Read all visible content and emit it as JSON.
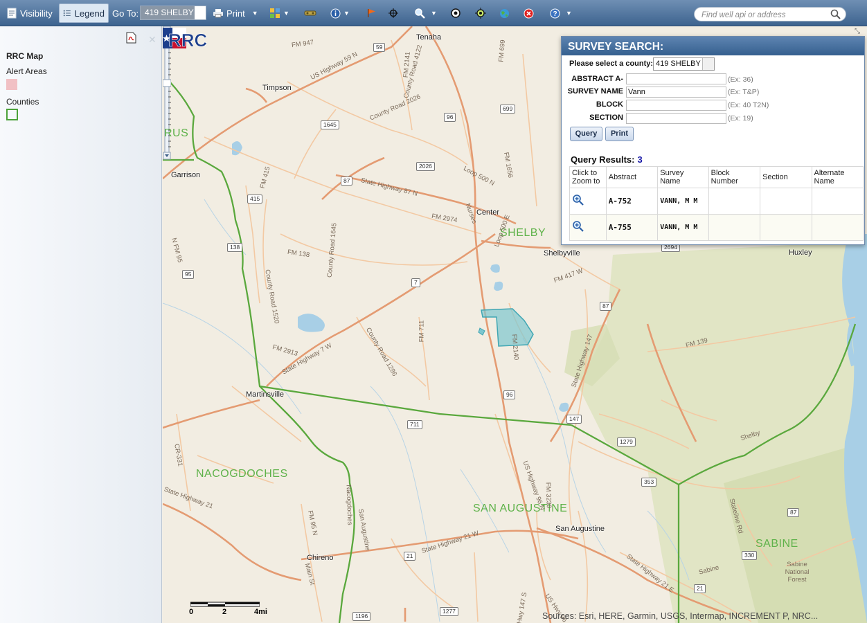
{
  "toolbar": {
    "visibility_label": "Visibility",
    "legend_label": "Legend",
    "goto_label": "Go To:",
    "goto_value": "419 SHELBY",
    "print_label": "Print",
    "search_placeholder": "Find well api or address"
  },
  "legend": {
    "title": "RRC Map",
    "items": [
      {
        "label": "Alert Areas",
        "color": "#f1c0c4"
      },
      {
        "label": "Counties",
        "color": "#4ca23a"
      }
    ]
  },
  "map": {
    "towns": [
      "Tenaha",
      "Timpson",
      "Garrison",
      "Center",
      "Shelbyville",
      "Huxley",
      "Martinsville",
      "Chireno",
      "San Augustine"
    ],
    "counties": [
      "SHELBY",
      "NACOGDOCHES",
      "SAN AUGUSTINE",
      "SABINE",
      "RUS"
    ],
    "roads": [
      "US Highway 59 N",
      "FM 947",
      "County Road 4122",
      "FM 2141",
      "FM 699",
      "County Road 2026",
      "Loop 500 N",
      "FM 1656",
      "State Highway 87 N",
      "FM 415",
      "FM 2974",
      "Loop 500 E",
      "FM 138",
      "County Road 1645",
      "FM 417 W",
      "County Road 1520",
      "FM 711",
      "FM 2913",
      "State Highway 7 W",
      "County Road 1286",
      "FM 2140",
      "FM 139",
      "State Highway 147",
      "Shelby",
      "N FM 95",
      "CR-331",
      "State Highway 21",
      "FM 95 N",
      "Nacogdoches",
      "San Augustine",
      "State Highway 21 W",
      "US Highway 96 N",
      "FM 3230",
      "State Highway 21 E",
      "Sabine",
      "Stateline Rd",
      "Main St",
      "Sabine National Forest",
      "Hwy 147 S",
      "US Hwy 96",
      "Nurses"
    ],
    "shields": [
      "59",
      "1645",
      "96",
      "699",
      "2026",
      "87",
      "415",
      "138",
      "95",
      "7",
      "87",
      "96",
      "147",
      "711",
      "1279",
      "353",
      "87",
      "330",
      "21",
      "21",
      "1196",
      "1277",
      "2694"
    ],
    "scale": {
      "labels": [
        "0",
        "2",
        "4mi"
      ]
    },
    "sources": "Sources: Esri, HERE, Garmin, USGS, Intermap, INCREMENT P, NRC..."
  },
  "survey": {
    "title": "SURVEY SEARCH:",
    "county_prompt": "Please select a county:",
    "county_value": "419 SHELBY",
    "fields": [
      {
        "label": "ABSTRACT A-",
        "value": "",
        "hint": "(Ex: 36)"
      },
      {
        "label": "SURVEY NAME",
        "value": "Vann",
        "hint": "(Ex: T&P)"
      },
      {
        "label": "BLOCK",
        "value": "",
        "hint": "(Ex: 40 T2N)"
      },
      {
        "label": "SECTION",
        "value": "",
        "hint": "(Ex: 19)"
      }
    ],
    "query_button": "Query",
    "print_button": "Print",
    "results_label": "Query Results:",
    "results_count": "3",
    "columns": [
      "Click to Zoom to",
      "Abstract",
      "Survey Name",
      "Block Number",
      "Section",
      "Alternate Name"
    ],
    "rows": [
      {
        "abstract": "A-752",
        "survey_name": "VANN, M M",
        "block": "",
        "section": "",
        "alternate": ""
      },
      {
        "abstract": "A-755",
        "survey_name": "VANN, M M",
        "block": "",
        "section": "",
        "alternate": ""
      }
    ]
  }
}
